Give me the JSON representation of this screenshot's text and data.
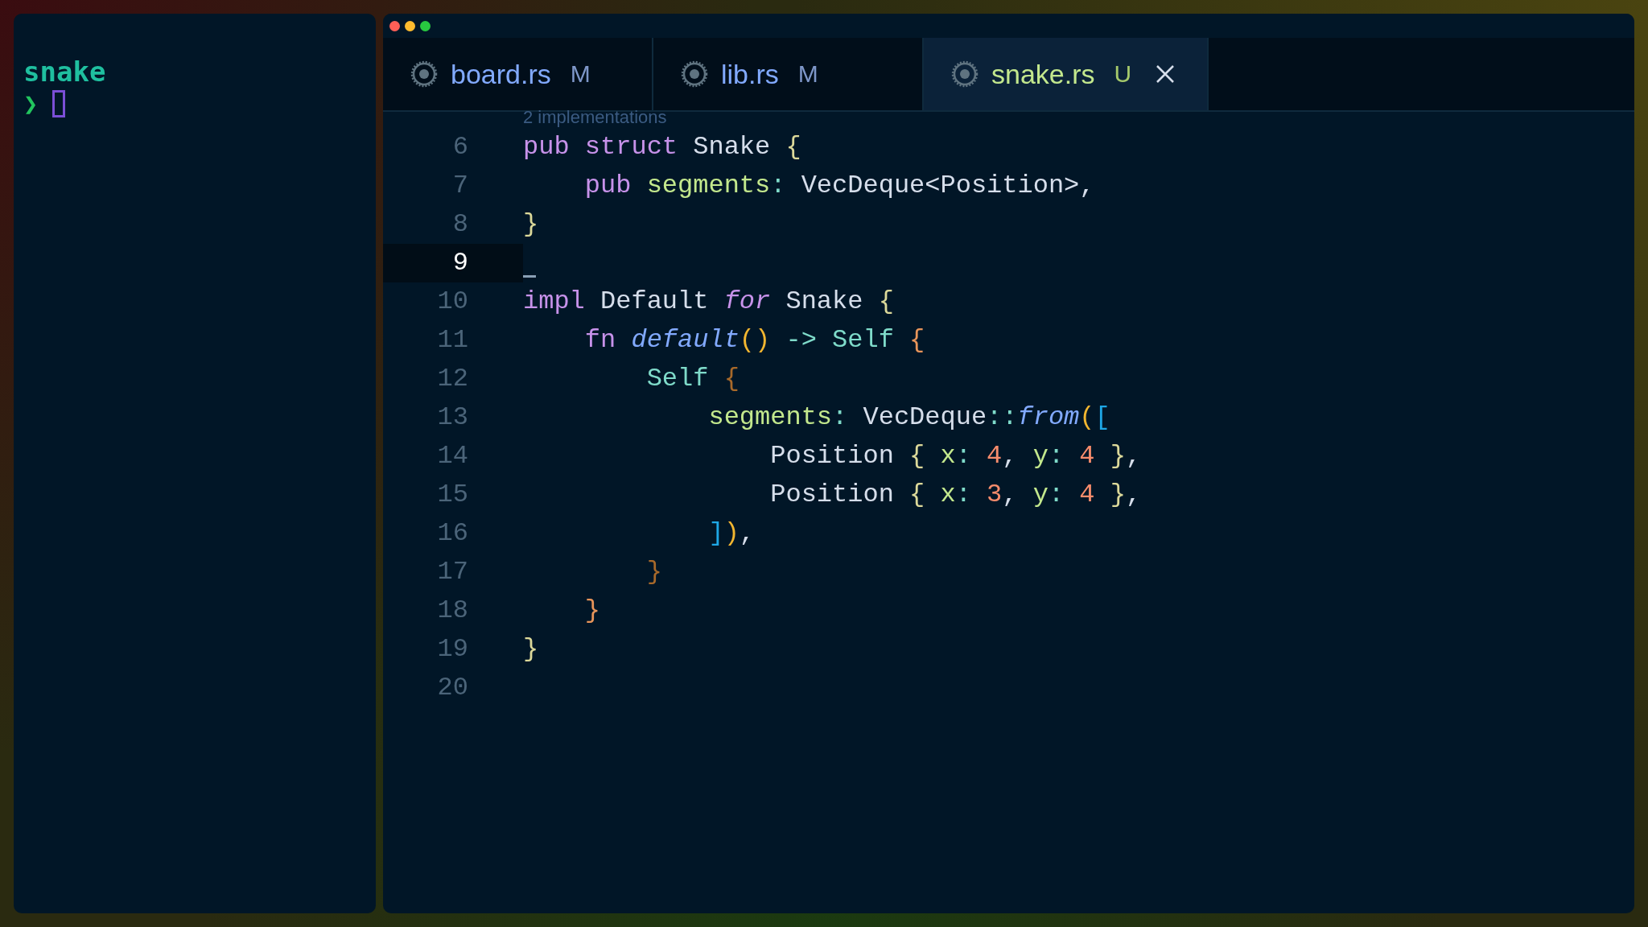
{
  "terminal": {
    "title": "snake",
    "prompt": "❯"
  },
  "window": {
    "controls": [
      {
        "kind": "close"
      },
      {
        "kind": "minimize"
      },
      {
        "kind": "zoom"
      }
    ]
  },
  "tabs": [
    {
      "label": "board.rs",
      "status": "M",
      "selected": false
    },
    {
      "label": "lib.rs",
      "status": "M",
      "selected": false
    },
    {
      "label": "snake.rs",
      "status": "U",
      "selected": true
    }
  ],
  "editor": {
    "codelens": "2 implementations",
    "lines": [
      {
        "number": "6",
        "current": false,
        "tokens": [
          {
            "kind": "kw",
            "text": "pub"
          },
          {
            "kind": "kw",
            "text": " struct"
          },
          {
            "kind": "plain",
            "text": " Snake "
          },
          {
            "kind": "b1",
            "text": "{"
          }
        ]
      },
      {
        "number": "7",
        "current": false,
        "tokens": [
          {
            "kind": "kw",
            "text": "    pub"
          },
          {
            "kind": "field",
            "text": " segments"
          },
          {
            "kind": "op",
            "text": ":"
          },
          {
            "kind": "plain",
            "text": " VecDeque<Position>,"
          }
        ]
      },
      {
        "number": "8",
        "current": false,
        "tokens": [
          {
            "kind": "b1",
            "text": "}"
          }
        ]
      },
      {
        "number": "9",
        "current": true
      },
      {
        "number": "10",
        "current": false,
        "tokens": [
          {
            "kind": "kw",
            "text": "impl"
          },
          {
            "kind": "plain",
            "text": " Default "
          },
          {
            "kind": "kwi",
            "text": "for"
          },
          {
            "kind": "plain",
            "text": " Snake "
          },
          {
            "kind": "b1",
            "text": "{"
          }
        ]
      },
      {
        "number": "11",
        "current": false,
        "tokens": [
          {
            "kind": "kw",
            "text": "    fn"
          },
          {
            "kind": "fn",
            "text": " default"
          },
          {
            "kind": "py",
            "text": "()"
          },
          {
            "kind": "op",
            "text": " -> "
          },
          {
            "kind": "self",
            "text": "Self"
          },
          {
            "kind": "b2",
            "text": " {"
          }
        ]
      },
      {
        "number": "12",
        "current": false,
        "tokens": [
          {
            "kind": "self",
            "text": "        Self"
          },
          {
            "kind": "b3",
            "text": " {"
          }
        ]
      },
      {
        "number": "13",
        "current": false,
        "tokens": [
          {
            "kind": "field",
            "text": "            segments"
          },
          {
            "kind": "op",
            "text": ":"
          },
          {
            "kind": "plain",
            "text": " VecDeque"
          },
          {
            "kind": "op",
            "text": "::"
          },
          {
            "kind": "fn",
            "text": "from"
          },
          {
            "kind": "py",
            "text": "("
          },
          {
            "kind": "pb",
            "text": "["
          }
        ]
      },
      {
        "number": "14",
        "current": false,
        "tokens": [
          {
            "kind": "plain",
            "text": "                Position "
          },
          {
            "kind": "b1",
            "text": "{"
          },
          {
            "kind": "field",
            "text": " x"
          },
          {
            "kind": "op",
            "text": ":"
          },
          {
            "kind": "num",
            "text": " 4"
          },
          {
            "kind": "plain",
            "text": ", "
          },
          {
            "kind": "field",
            "text": "y"
          },
          {
            "kind": "op",
            "text": ":"
          },
          {
            "kind": "num",
            "text": " 4"
          },
          {
            "kind": "b1",
            "text": " }"
          },
          {
            "kind": "plain",
            "text": ","
          }
        ]
      },
      {
        "number": "15",
        "current": false,
        "tokens": [
          {
            "kind": "plain",
            "text": "                Position "
          },
          {
            "kind": "b1",
            "text": "{"
          },
          {
            "kind": "field",
            "text": " x"
          },
          {
            "kind": "op",
            "text": ":"
          },
          {
            "kind": "num",
            "text": " 3"
          },
          {
            "kind": "plain",
            "text": ", "
          },
          {
            "kind": "field",
            "text": "y"
          },
          {
            "kind": "op",
            "text": ":"
          },
          {
            "kind": "num",
            "text": " 4"
          },
          {
            "kind": "b1",
            "text": " }"
          },
          {
            "kind": "plain",
            "text": ","
          }
        ]
      },
      {
        "number": "16",
        "current": false,
        "tokens": [
          {
            "kind": "pb",
            "text": "            ]"
          },
          {
            "kind": "py",
            "text": ")"
          },
          {
            "kind": "plain",
            "text": ","
          }
        ]
      },
      {
        "number": "17",
        "current": false,
        "tokens": [
          {
            "kind": "b3",
            "text": "        }"
          }
        ]
      },
      {
        "number": "18",
        "current": false,
        "tokens": [
          {
            "kind": "b2",
            "text": "    }"
          }
        ]
      },
      {
        "number": "19",
        "current": false,
        "tokens": [
          {
            "kind": "b1",
            "text": "}"
          }
        ]
      },
      {
        "number": "20",
        "current": false
      }
    ]
  }
}
